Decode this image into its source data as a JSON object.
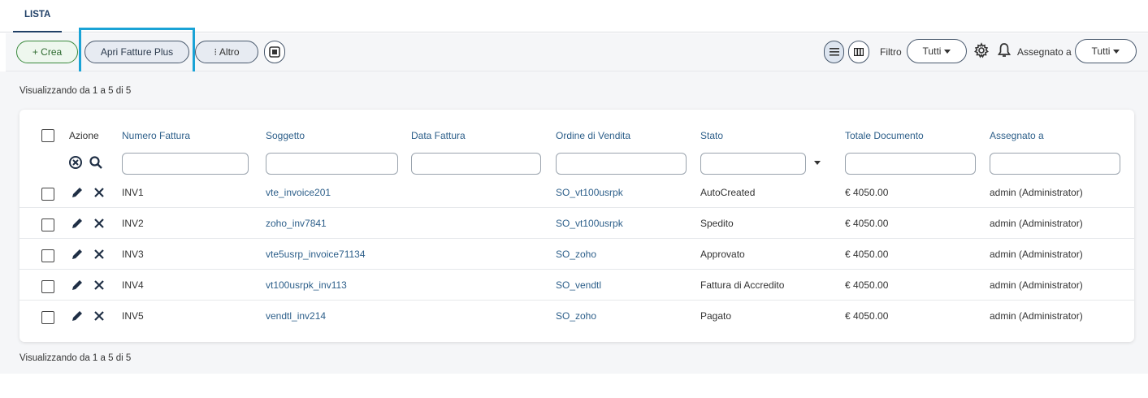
{
  "tab": {
    "label": "LISTA"
  },
  "toolbar": {
    "crea_label": "+ Crea",
    "apri_label": "Apri Fatture Plus",
    "altro_label": "⁝ Altro",
    "filtro_label": "Filtro",
    "filtro_value": "Tutti",
    "assegnato_label": "Assegnato a",
    "assegnato_value": "Tutti"
  },
  "summary": {
    "text": "Visualizzando da 1 a 5 di 5"
  },
  "table": {
    "columns": [
      "Azione",
      "Numero Fattura",
      "Soggetto",
      "Data Fattura",
      "Ordine di Vendita",
      "Stato",
      "Totale Documento",
      "Assegnato a"
    ],
    "rows": [
      {
        "numero": "INV1",
        "soggetto": "vte_invoice201",
        "data": "",
        "ordine": "SO_vt100usrpk",
        "stato": "AutoCreated",
        "totale": "€ 4050.00",
        "assegnato": "admin (Administrator)"
      },
      {
        "numero": "INV2",
        "soggetto": "zoho_inv7841",
        "data": "",
        "ordine": "SO_vt100usrpk",
        "stato": "Spedito",
        "totale": "€ 4050.00",
        "assegnato": "admin (Administrator)"
      },
      {
        "numero": "INV3",
        "soggetto": "vte5usrp_invoice71134",
        "data": "",
        "ordine": "SO_zoho",
        "stato": "Approvato",
        "totale": "€ 4050.00",
        "assegnato": "admin (Administrator)"
      },
      {
        "numero": "INV4",
        "soggetto": "vt100usrpk_inv113",
        "data": "",
        "ordine": "SO_vendtl",
        "stato": "Fattura di Accredito",
        "totale": "€ 4050.00",
        "assegnato": "admin (Administrator)"
      },
      {
        "numero": "INV5",
        "soggetto": "vendtl_inv214",
        "data": "",
        "ordine": "SO_zoho",
        "stato": "Pagato",
        "totale": "€ 4050.00",
        "assegnato": "admin (Administrator)"
      }
    ]
  },
  "icons": {
    "edit": "pencil-icon",
    "delete": "close-icon",
    "clear_filters": "circle-x-icon",
    "search": "search-icon",
    "settings": "gear-icon",
    "notifications": "bell-icon"
  },
  "colors": {
    "accent": "#2d5f8a",
    "highlight": "#1aa3d6",
    "create": "#3b8a3e"
  }
}
